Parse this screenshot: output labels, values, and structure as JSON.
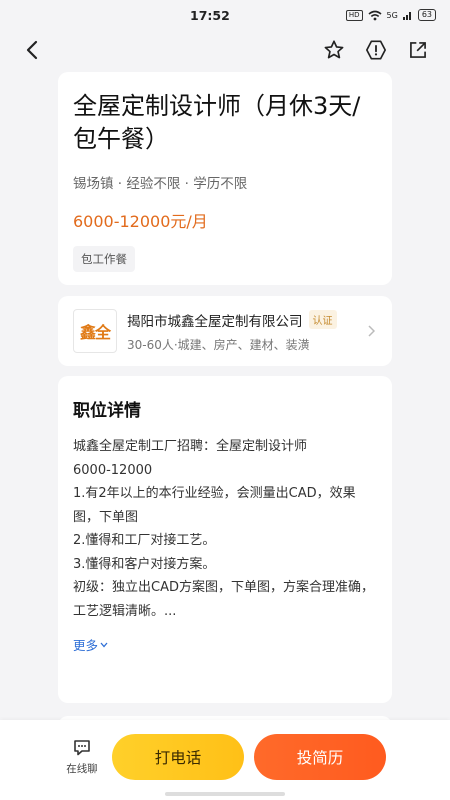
{
  "status": {
    "time": "17:52",
    "hd": "HD",
    "signal": "5G",
    "battery": "63"
  },
  "nav": {
    "back_icon": "chevron-left-icon",
    "star_icon": "star-icon",
    "report_icon": "warning-icon",
    "share_icon": "share-icon"
  },
  "job": {
    "title": "全屋定制设计师（月休3天/包午餐）",
    "tags": "锡场镇 · 经验不限 · 学历不限",
    "salary": "6000-12000元/月",
    "benefit": "包工作餐"
  },
  "company": {
    "logo_text": "鑫全",
    "name": "揭阳市城鑫全屋定制有限公司",
    "verified": "认证",
    "meta": "30-60人·城建、房产、建材、装潢"
  },
  "detail": {
    "title": "职位详情",
    "lines": [
      "城鑫全屋定制工厂招聘：全屋定制设计师",
      "6000-12000",
      "1.有2年以上的本行业经验，会测量出CAD，效果图，下单图",
      "2.懂得和工厂对接工艺。",
      "3.懂得和客户对接方案。",
      "初级：独立出CAD方案图，下单图，方案合理准确，工艺逻辑清晰。..."
    ],
    "more": "更多"
  },
  "actions": {
    "chat": "在线聊",
    "call": "打电话",
    "apply": "投简历"
  },
  "colors": {
    "salary": "#e26b1d",
    "call_btn": "#ffc51d",
    "apply_btn": "#ff5f24",
    "link": "#2f6fd6"
  }
}
